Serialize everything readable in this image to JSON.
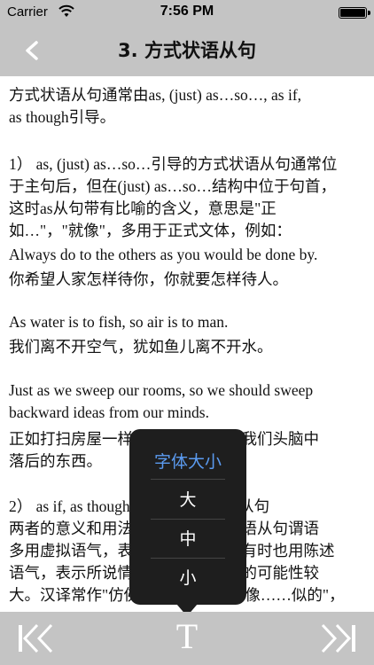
{
  "status_bar": {
    "carrier": "Carrier",
    "time": "7:56 PM"
  },
  "nav": {
    "title": "3. 方式状语从句",
    "back_icon": "chevron-left-icon"
  },
  "content": {
    "lines": [
      "    方式状语从句通常由as, (just) as…so…, as if,",
      "as though引导。",
      "",
      "1） as, (just) as…so…引导的方式状语从句通常位",
      "于主句后，但在(just) as…so…结构中位于句首，",
      "这时as从句带有比喻的含义，意思是\"正",
      "如…\"，\"就像\"，多用于正式文体，例如：",
      "  Always do to the others as you would be done by.",
      "  你希望人家怎样待你，你就要怎样待人。",
      "",
      "  As water is to fish, so air is to man.",
      "  我们离不开空气，犹如鱼儿离不开水。",
      "",
      "  Just as we sweep our rooms, so we should sweep",
      "backward ideas from our minds.",
      "  正如打扫房屋一样，我们也应扫除我们头脑中",
      "落后的东西。",
      "",
      "2） as if, as though引导的方式状语从句",
      "  两者的意义和用法相同，引出的状语从句谓语",
      "多用虚拟语气，表示与事实相反，有时也用陈述",
      "语气，表示所说情况是事实或实现的可能性较",
      "大。汉译常作\"仿佛……似的\"，\"好像……似的\"，"
    ]
  },
  "font_popover": {
    "title": "字体大小",
    "options": [
      "大",
      "中",
      "小"
    ]
  },
  "toolbar": {
    "prev_icon": "skip-back-icon",
    "font_icon_label": "T",
    "next_icon": "skip-forward-icon"
  },
  "colors": {
    "bar": "#c4c4c4",
    "popover": "#1e1e1e",
    "accent": "#5b9bf0"
  }
}
